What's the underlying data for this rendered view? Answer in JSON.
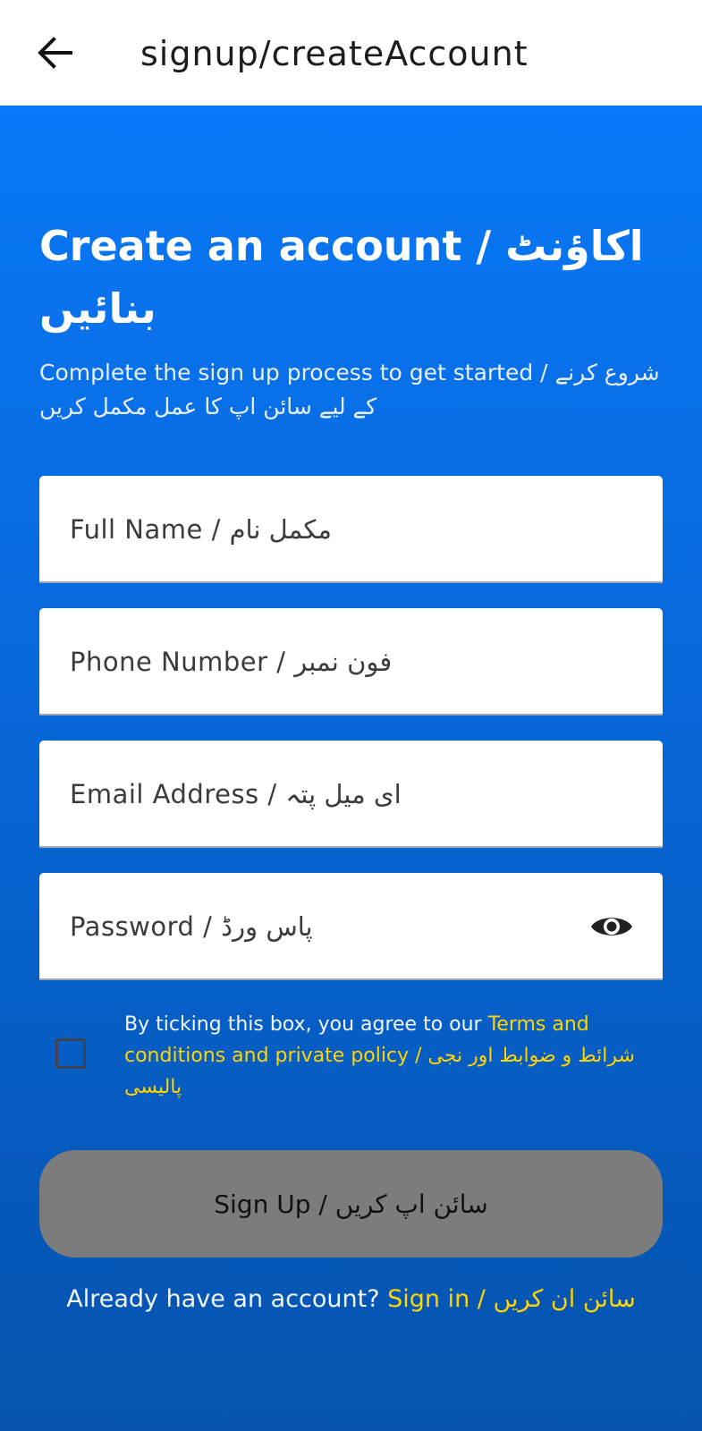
{
  "app_bar": {
    "title": "signup/createAccount",
    "back_icon": "arrow-left-icon"
  },
  "main": {
    "heading": "Create an account / اکاؤنٹ بنائیں",
    "subheading": "Complete the sign up process to get started / شروع کرنے کے لیے سائن اپ کا عمل مکمل کریں"
  },
  "form": {
    "full_name_placeholder": "Full Name / مکمل نام",
    "phone_placeholder": "Phone Number / فون نمبر",
    "email_placeholder": "Email Address / ای میل پتہ",
    "password_placeholder": "Password / پاس ورڈ",
    "password_toggle_icon": "eye-icon",
    "terms_prefix": "By ticking this box, you agree to our ",
    "terms_link": "Terms and conditions and private policy / شرائط و ضوابط اور نجی پالیسی",
    "terms_checked": false,
    "signup_label": "Sign Up / سائن اپ کریں"
  },
  "footer": {
    "signin_prompt": "Already have an account? ",
    "signin_link": "Sign in / سائن ان کریں"
  },
  "colors": {
    "primary_blue": "#0a78f7",
    "link_yellow": "#ffd400",
    "disabled_button": "#7c7c7c"
  }
}
